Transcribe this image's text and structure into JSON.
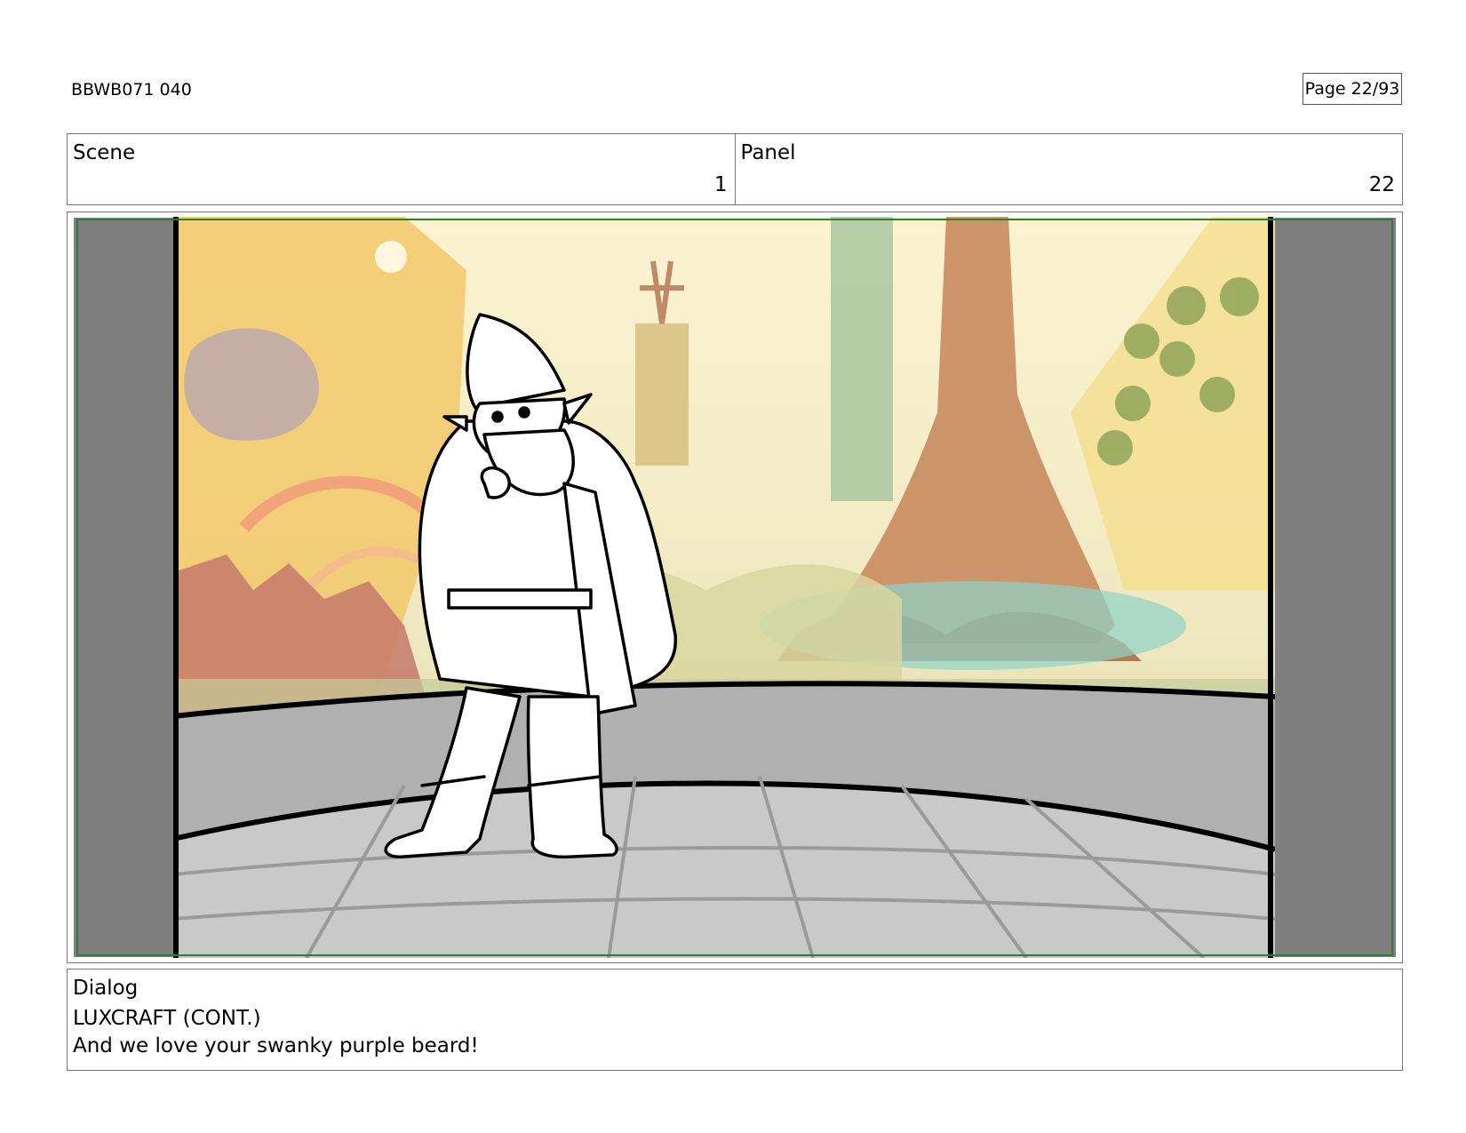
{
  "header": {
    "doc_id": "BBWB071 040",
    "page": "Page 22/93"
  },
  "info": {
    "scene_label": "Scene",
    "scene_value": "1",
    "panel_label": "Panel",
    "panel_value": "22"
  },
  "dialog": {
    "label": "Dialog",
    "character": "LUXCRAFT (CONT.)",
    "line": "And we love your swanky purple beard!"
  },
  "colors": {
    "safe_frame": "#2e7d32",
    "letterbox": "#7f7f7f",
    "wall": "#b0b0b0",
    "floor": "#c8c8c8"
  }
}
